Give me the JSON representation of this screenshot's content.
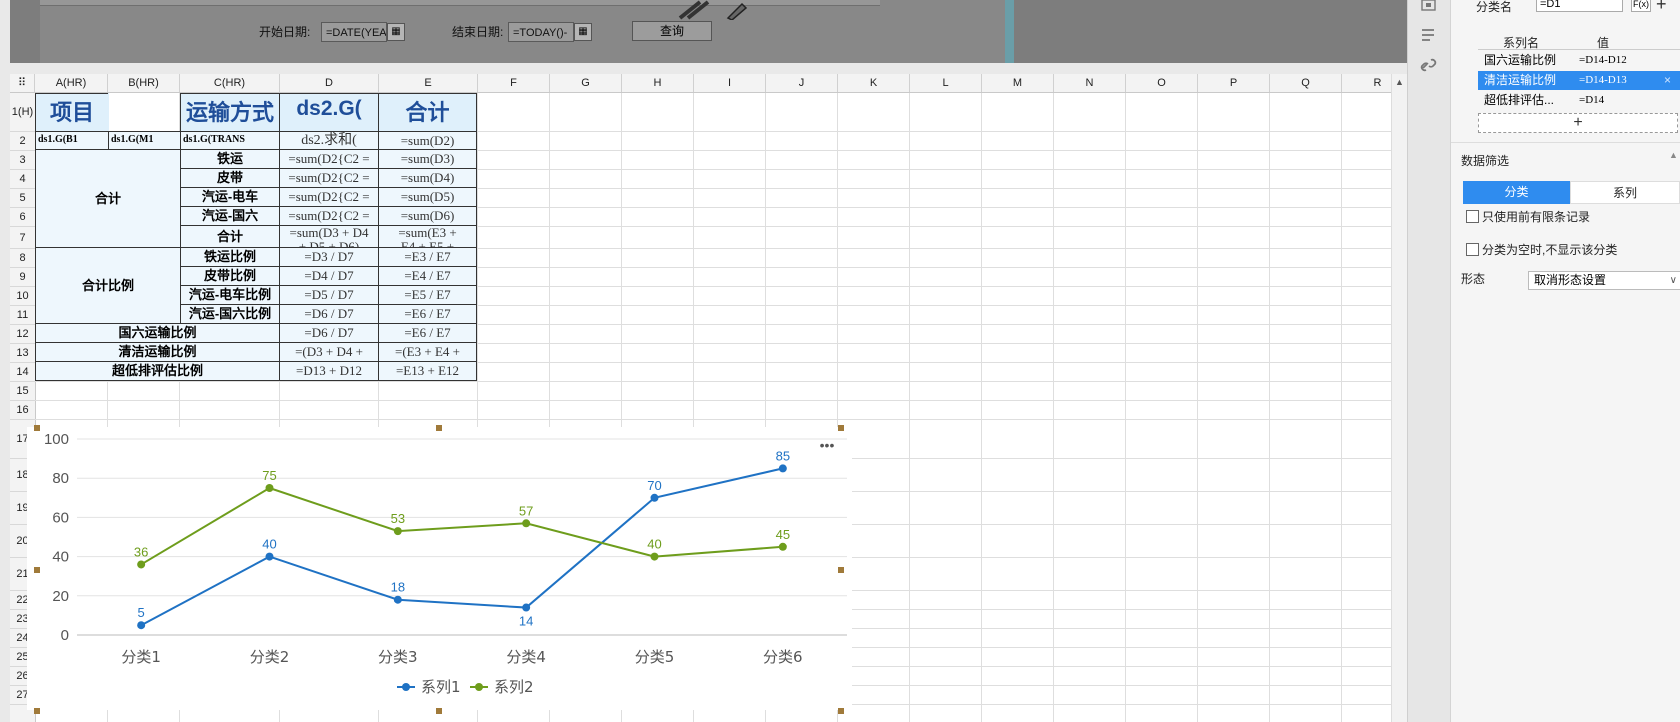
{
  "preview": {
    "start_label": "开始日期:",
    "start_value": "=DATE(YEA",
    "end_label": "结束日期:",
    "end_value": "=TODAY()-",
    "query_button": "查询"
  },
  "columns": [
    "A(HR)",
    "B(HR)",
    "C(HR)",
    "D",
    "E",
    "F",
    "G",
    "H",
    "I",
    "J",
    "K",
    "L",
    "M",
    "N",
    "O",
    "P",
    "Q",
    "R"
  ],
  "rows": [
    "1(H)",
    "2",
    "3",
    "4",
    "5",
    "6",
    "7",
    "8",
    "9",
    "10",
    "11",
    "12",
    "13",
    "14",
    "15",
    "16",
    "17",
    "18",
    "19",
    "20",
    "21",
    "22",
    "23",
    "24",
    "25",
    "26",
    "27"
  ],
  "cells": {
    "a1": "项目",
    "c1": "运输方式",
    "d1": "ds2.G(",
    "e1": "合计",
    "a2": "ds1.G(B1",
    "b2": "ds1.G(M1",
    "c2": "ds1.G(TRANS",
    "d2": "ds2.求和(",
    "e2": "=sum(D2)",
    "group_total": "合计",
    "group_ratio": "合计比例",
    "c3": "铁运",
    "c4": "皮带",
    "c5": "汽运-电车",
    "c6": "汽运-国六",
    "c7": "合计",
    "c8": "铁运比例",
    "c9": "皮带比例",
    "c10": "汽运-电车比例",
    "c11": "汽运-国六比例",
    "d3": "=sum(D2{C2 =",
    "d4": "=sum(D2{C2 =",
    "d5": "=sum(D2{C2 =",
    "d6": "=sum(D2{C2 =",
    "d7": "=sum(D3 + D4",
    "d7b": "+ D5 + D6)",
    "e3": "=sum(D3)",
    "e4": "=sum(D4)",
    "e5": "=sum(D5)",
    "e6": "=sum(D6)",
    "e7": "=sum(E3 +",
    "e7b": "E4 + E5 +",
    "d8": "=D3 / D7",
    "d9": "=D4 / D7",
    "d10": "=D5 / D7",
    "d11": "=D6 / D7",
    "e8": "=E3 / E7",
    "e9": "=E4 / E7",
    "e10": "=E5 / E7",
    "e11": "=E6 / E7",
    "r12": "国六运输比例",
    "r13": "清洁运输比例",
    "r14": "超低排评估比例",
    "d12": "=D6 / D7",
    "e12": "=E6 / E7",
    "d13": "=(D3 + D4 +",
    "e13": "=(E3 + E4 +",
    "d14": "=D13 + D12",
    "e14": "=E13 + E12"
  },
  "chart_data": {
    "type": "line",
    "categories": [
      "分类1",
      "分类2",
      "分类3",
      "分类4",
      "分类5",
      "分类6"
    ],
    "series": [
      {
        "name": "系列1",
        "values": [
          5,
          40,
          18,
          14,
          70,
          85
        ],
        "color": "#1f72c4"
      },
      {
        "name": "系列2",
        "values": [
          36,
          75,
          53,
          57,
          40,
          45
        ],
        "color": "#6e9d1c"
      }
    ],
    "ylim": [
      0,
      100
    ],
    "yticks": [
      0,
      20,
      40,
      60,
      80,
      100
    ],
    "grid": true,
    "legend": "bottom",
    "data_labels": true,
    "more_menu": "•••"
  },
  "panel": {
    "category_name_label": "分类名",
    "category_name_value": "=D1",
    "fx_button": "F(x)",
    "add_icon": "+",
    "series_col_name": "系列名",
    "series_col_value": "值",
    "series": [
      {
        "name": "国六运输比例",
        "value": "=D14-D12"
      },
      {
        "name": "清洁运输比例",
        "value": "=D14-D13"
      },
      {
        "name": "超低排评估...",
        "value": "=D14"
      }
    ],
    "remove_icon": "×",
    "add_series": "+",
    "filter_title": "数据筛选",
    "tab_category": "分类",
    "tab_series": "系列",
    "check_top_records": "只使用前有限条记录",
    "check_hide_empty": "分类为空时,不显示该分类",
    "form_label": "形态",
    "form_value": "取消形态设置"
  },
  "colors": {
    "accent": "#2f8cef",
    "header_text": "#1f4e99",
    "series1": "#1f72c4",
    "series2": "#6e9d1c"
  }
}
